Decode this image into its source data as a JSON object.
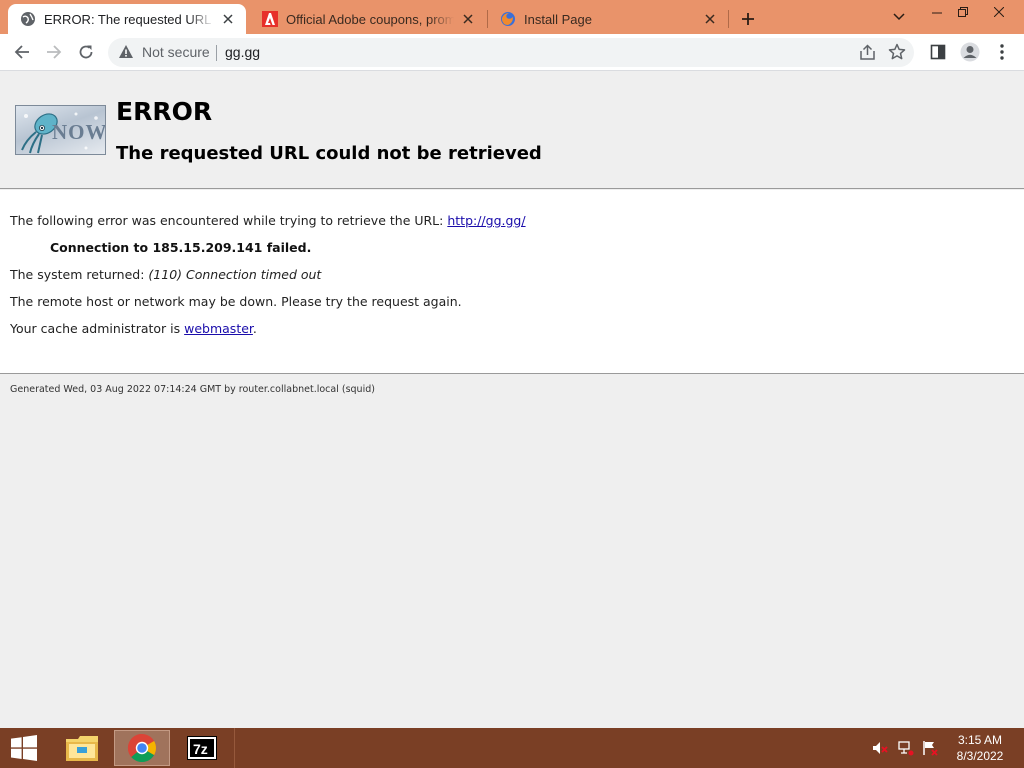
{
  "browser": {
    "tabs": [
      {
        "title": "ERROR: The requested URL could not be retrieved",
        "favicon": "globe-icon",
        "active": true
      },
      {
        "title": "Official Adobe coupons, promos & deals",
        "favicon": "adobe-icon",
        "active": false
      },
      {
        "title": "Install Page",
        "favicon": "firefox-icon",
        "active": false
      }
    ],
    "security_label": "Not secure",
    "url": "gg.gg"
  },
  "page": {
    "title": "ERROR",
    "subtitle": "The requested URL could not be retrieved",
    "logo_text": "NOW",
    "line1_prefix": "The following error was encountered while trying to retrieve the URL: ",
    "line1_link": "http://gg.gg/",
    "line2": "Connection to 185.15.209.141 failed.",
    "line3_prefix": "The system returned: ",
    "line3_italic": "(110) Connection timed out",
    "line4": "The remote host or network may be down. Please try the request again.",
    "line5_prefix": "Your cache administrator is ",
    "line5_link": "webmaster",
    "line5_suffix": ".",
    "footer": "Generated Wed, 03 Aug 2022 07:14:24 GMT by router.collabnet.local (squid)"
  },
  "taskbar": {
    "apps": [
      "file-explorer-icon",
      "chrome-icon",
      "7zip-icon"
    ],
    "tray": [
      "volume-muted-icon",
      "network-icon",
      "action-center-icon"
    ],
    "time": "3:15 AM",
    "date": "8/3/2022"
  },
  "colors": {
    "titlebar": "#e9936a",
    "taskbar": "#7a3f25",
    "link": "#1a0dab"
  }
}
